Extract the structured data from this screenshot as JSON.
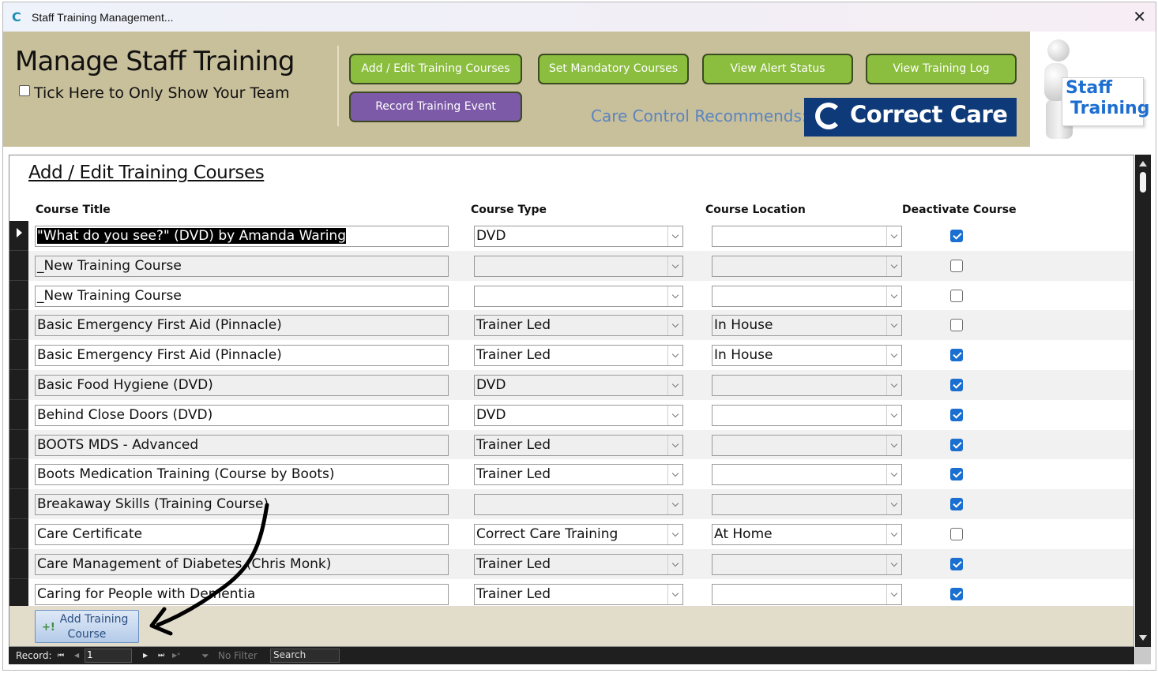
{
  "window": {
    "title": "Staff Training Management...",
    "app_icon": "C",
    "close_glyph": "✕"
  },
  "header": {
    "title": "Manage Staff Training",
    "team_checkbox_label": "Tick Here to Only Show Your Team",
    "team_checkbox_checked": false,
    "buttons": {
      "add_edit": "Add / Edit Training Courses",
      "mandatory": "Set Mandatory Courses",
      "alert_status": "View Alert Status",
      "training_log": "View Training Log",
      "record_event": "Record Training Event"
    },
    "recommend_text": "Care Control Recommends:",
    "logo_text": "Correct Care",
    "staff_sign": [
      "Staff",
      "Training"
    ]
  },
  "colors": {
    "header_bg": "#c8bf9b",
    "green_button": "#8bbd3f",
    "purple_button": "#7c5aa7",
    "logo_bg": "#0f3a79",
    "checkbox_on": "#1a6fd1"
  },
  "form": {
    "heading": "Add / Edit Training Courses",
    "columns": {
      "title": "Course Title",
      "type": "Course Type",
      "location": "Course Location",
      "deactivate": "Deactivate Course"
    },
    "rows": [
      {
        "title": "\"What do you see?\" (DVD) by Amanda Waring",
        "type": "DVD",
        "location": "",
        "deactivated": true,
        "current": true
      },
      {
        "title": "_New Training Course",
        "type": "",
        "location": "",
        "deactivated": false
      },
      {
        "title": "_New Training Course",
        "type": "",
        "location": "",
        "deactivated": false
      },
      {
        "title": "Basic Emergency First Aid (Pinnacle)",
        "type": "Trainer Led",
        "location": "In House",
        "deactivated": false
      },
      {
        "title": "Basic Emergency First Aid (Pinnacle)",
        "type": "Trainer Led",
        "location": "In House",
        "deactivated": true
      },
      {
        "title": "Basic Food Hygiene (DVD)",
        "type": "DVD",
        "location": "",
        "deactivated": true
      },
      {
        "title": "Behind Close Doors (DVD)",
        "type": "DVD",
        "location": "",
        "deactivated": true
      },
      {
        "title": "BOOTS MDS - Advanced",
        "type": "Trainer Led",
        "location": "",
        "deactivated": true
      },
      {
        "title": "Boots Medication Training (Course by Boots)",
        "type": "Trainer Led",
        "location": "",
        "deactivated": true
      },
      {
        "title": "Breakaway Skills (Training Course)",
        "type": "",
        "location": "",
        "deactivated": true
      },
      {
        "title": "Care Certificate",
        "type": "Correct Care Training",
        "location": "At Home",
        "deactivated": false
      },
      {
        "title": "Care Management of Diabetes (Chris Monk)",
        "type": "Trainer Led",
        "location": "",
        "deactivated": true
      },
      {
        "title": "Caring for People with Dementia",
        "type": "Trainer Led",
        "location": "",
        "deactivated": true
      }
    ],
    "add_button": {
      "line1": "Add Training",
      "line2": "Course"
    }
  },
  "navbar": {
    "record_label": "Record:",
    "record_value": "1",
    "first_glyph": "⏮",
    "prev_glyph": "◀",
    "next_glyph": "▶",
    "last_glyph": "⏭",
    "new_glyph": "▶*",
    "filter_label": "No Filter",
    "search_label": "Search"
  }
}
